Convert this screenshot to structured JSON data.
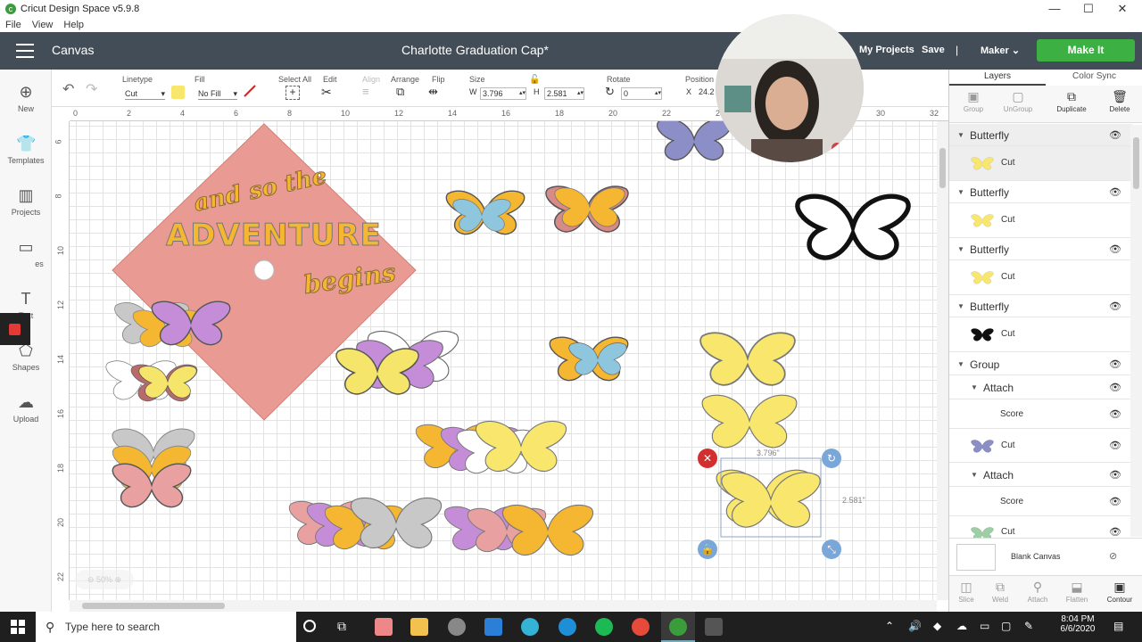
{
  "window": {
    "title": "Cricut Design Space  v5.9.8",
    "minimize": "—",
    "maximize": "☐",
    "close": "✕"
  },
  "menu": [
    "File",
    "View",
    "Help"
  ],
  "header": {
    "section": "Canvas",
    "project_title": "Charlotte Graduation Cap*",
    "my_projects": "My Projects",
    "save": "Save",
    "separator": "|",
    "machine": "Maker",
    "make_it": "Make It",
    "accent": "#3cb043",
    "bg": "#424d57"
  },
  "left_tools": [
    {
      "label": "New",
      "icon": "plus-circle-icon"
    },
    {
      "label": "Templates",
      "icon": "shirt-icon"
    },
    {
      "label": "Projects",
      "icon": "projects-icon"
    },
    {
      "label": "es",
      "icon": "images-icon"
    },
    {
      "label": "Text",
      "icon": "text-icon"
    },
    {
      "label": "Shapes",
      "icon": "shapes-icon"
    },
    {
      "label": "Upload",
      "icon": "upload-icon"
    }
  ],
  "edit_toolbar": {
    "linetype_label": "Linetype",
    "linetype_value": "Cut",
    "fill_label": "Fill",
    "fill_value": "No Fill",
    "select_all": "Select All",
    "edit": "Edit",
    "align": "Align",
    "arrange": "Arrange",
    "flip": "Flip",
    "size_label": "Size",
    "w_label": "W",
    "w_value": "3.796",
    "h_label": "H",
    "h_value": "2.581",
    "rotate_label": "Rotate",
    "rotate_value": "0",
    "position_label": "Position",
    "x_label": "X",
    "x_value": "24.2",
    "swatch_color": "#f9e66d"
  },
  "ruler": {
    "h": [
      "0",
      "2",
      "4",
      "6",
      "8",
      "10",
      "12",
      "14",
      "16",
      "18",
      "20",
      "22",
      "24",
      "26",
      "28",
      "30",
      "32"
    ],
    "v": [
      "6",
      "8",
      "10",
      "12",
      "14",
      "16",
      "18",
      "20",
      "22"
    ]
  },
  "canvas": {
    "cap_text_1": "and so the",
    "cap_text_2": "ADVENTURE",
    "cap_text_3": "begins",
    "dim_width": "3.796\"",
    "dim_height": "2.581\"",
    "zoom": "50%"
  },
  "right_panel": {
    "tabs": [
      "Layers",
      "Color Sync"
    ],
    "actions": [
      "Group",
      "UnGroup",
      "Duplicate",
      "Delete"
    ],
    "layers": [
      {
        "name": "Butterfly",
        "op": "Cut",
        "thumb": "yellow"
      },
      {
        "name": "Butterfly",
        "op": "Cut",
        "thumb": "yellow"
      },
      {
        "name": "Butterfly",
        "op": "Cut",
        "thumb": "yellow"
      },
      {
        "name": "Butterfly",
        "op": "Cut",
        "thumb": "black"
      }
    ],
    "group": {
      "name": "Group",
      "attach_label": "Attach",
      "score": "Score",
      "cut": "Cut"
    },
    "blank_canvas": "Blank Canvas",
    "bottom_actions": [
      "Slice",
      "Weld",
      "Attach",
      "Flatten",
      "Contour"
    ]
  },
  "taskbar": {
    "search_placeholder": "Type here to search",
    "time": "8:04 PM",
    "date": "6/6/2020"
  }
}
